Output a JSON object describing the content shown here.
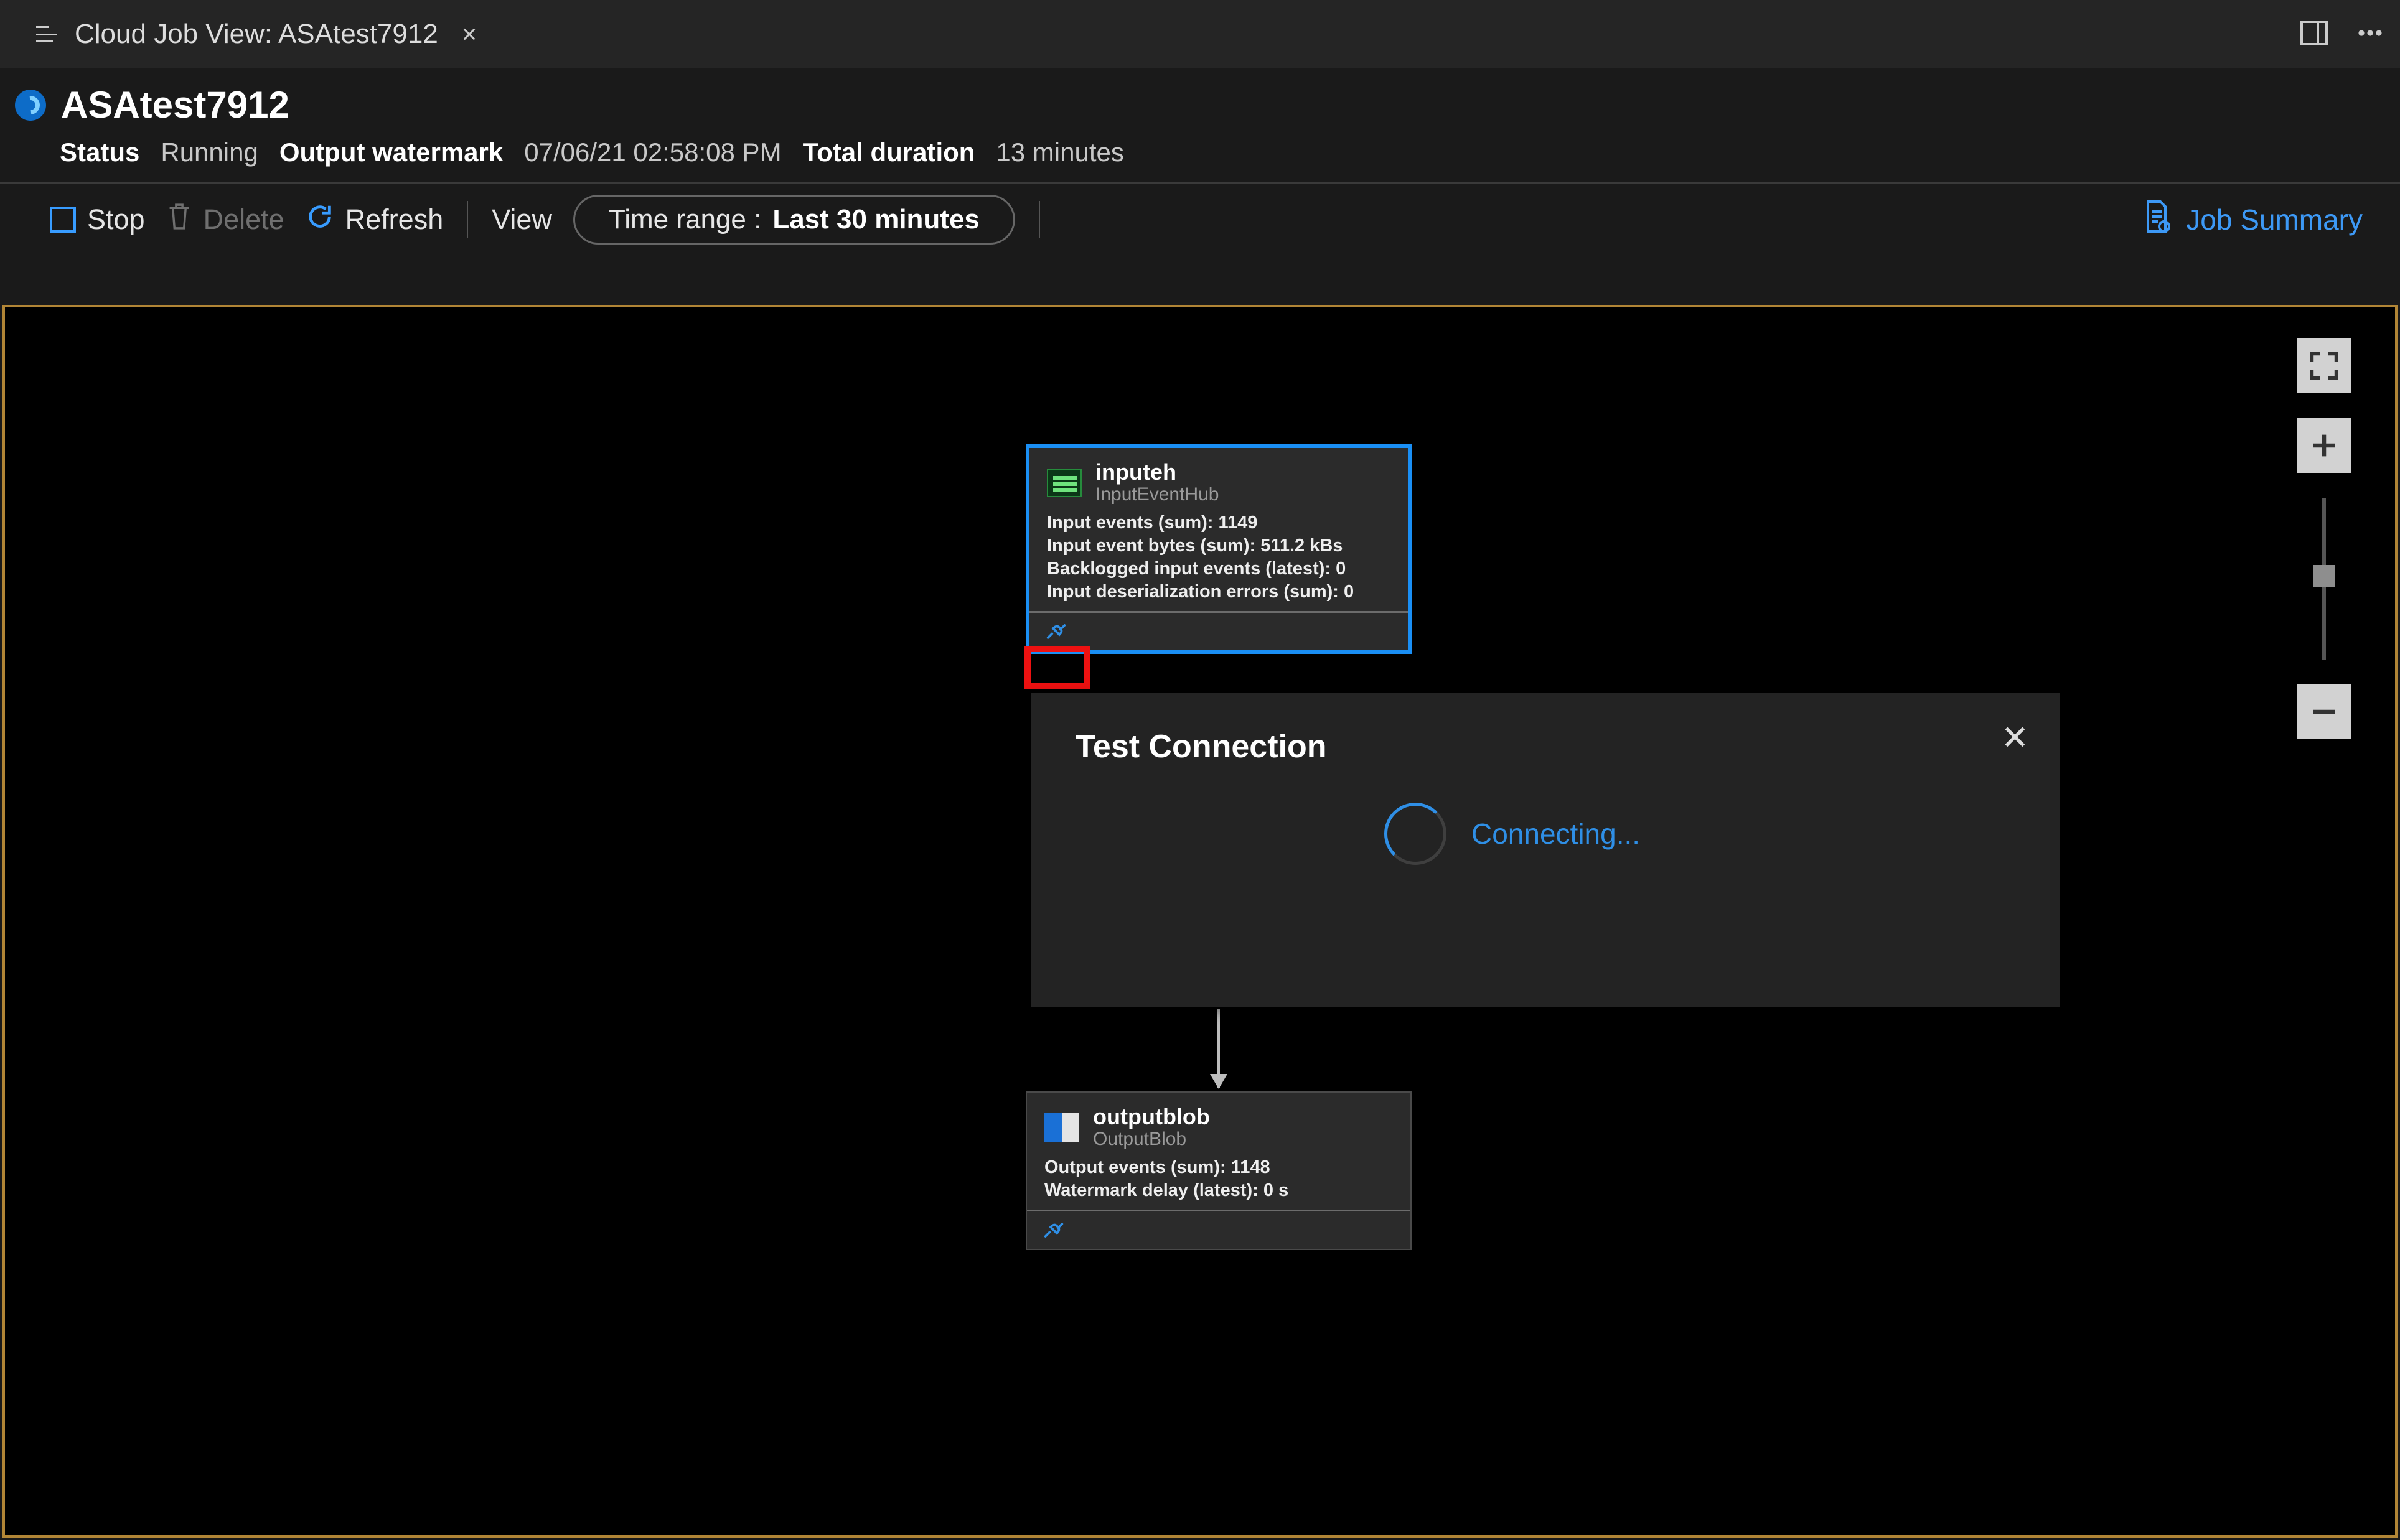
{
  "tab": {
    "title": "Cloud Job View: ASAtest7912"
  },
  "header": {
    "jobName": "ASAtest7912",
    "statusLabel": "Status",
    "statusValue": "Running",
    "watermarkLabel": "Output watermark",
    "watermarkValue": "07/06/21 02:58:08 PM",
    "durationLabel": "Total duration",
    "durationValue": "13 minutes"
  },
  "toolbar": {
    "stop": "Stop",
    "delete": "Delete",
    "refresh": "Refresh",
    "view": "View",
    "timeRangeLabel": "Time range :",
    "timeRangeValue": "Last 30 minutes",
    "jobSummary": "Job Summary"
  },
  "nodes": {
    "input": {
      "name": "inputeh",
      "type": "InputEventHub",
      "metrics": {
        "events": "Input events (sum): 1149",
        "bytes": "Input event bytes (sum): 511.2 kBs",
        "backlog": "Backlogged input events (latest): 0",
        "errors": "Input deserialization errors (sum): 0"
      }
    },
    "output": {
      "name": "outputblob",
      "type": "OutputBlob",
      "metrics": {
        "events": "Output events (sum): 1148",
        "delay": "Watermark delay (latest): 0 s"
      }
    }
  },
  "dialog": {
    "title": "Test Connection",
    "status": "Connecting..."
  }
}
